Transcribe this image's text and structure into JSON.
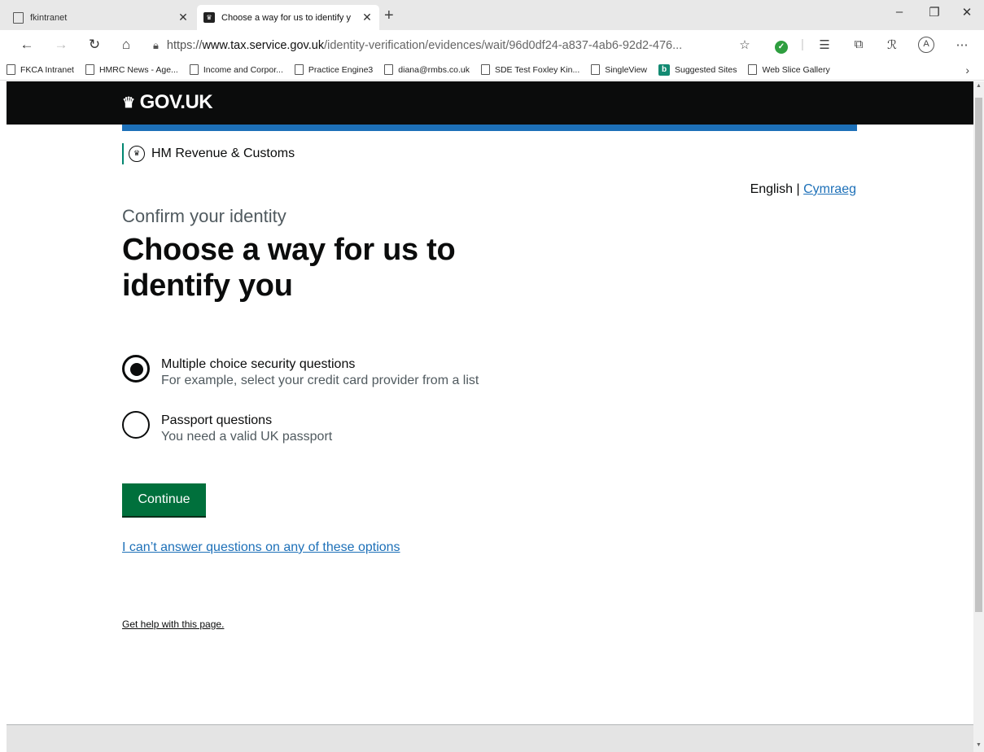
{
  "browser": {
    "tabs": [
      {
        "title": "fkintranet",
        "active": false
      },
      {
        "title": "Choose a way for us to identify y",
        "active": true
      }
    ],
    "url": {
      "scheme": "https://",
      "host": "www.tax.service.gov.uk",
      "path": "/identity-verification/evidences/wait/96d0df24-a837-4ab6-92d2-476..."
    },
    "favorites": [
      {
        "label": "FKCA Intranet",
        "icon": "page-icon"
      },
      {
        "label": "HMRC News - Age...",
        "icon": "page-icon"
      },
      {
        "label": "Income and Corpor...",
        "icon": "page-icon"
      },
      {
        "label": "Practice Engine3",
        "icon": "page-icon"
      },
      {
        "label": "diana@rmbs.co.uk",
        "icon": "page-icon"
      },
      {
        "label": "SDE Test  Foxley Kin...",
        "icon": "page-icon"
      },
      {
        "label": "SingleView",
        "icon": "page-icon"
      },
      {
        "label": "Suggested Sites",
        "icon": "bing-icon"
      },
      {
        "label": "Web Slice Gallery",
        "icon": "page-icon"
      }
    ]
  },
  "page": {
    "logo_text": "GOV.UK",
    "service_name": "HM Revenue & Customs",
    "lang_current": "English",
    "lang_separator": " | ",
    "lang_other": "Cymraeg",
    "caption": "Confirm your identity",
    "heading": "Choose a way for us to identify you",
    "options": [
      {
        "label": "Multiple choice security questions",
        "hint": "For example, select your credit card provider from a list",
        "checked": true
      },
      {
        "label": "Passport questions",
        "hint": "You need a valid UK passport",
        "checked": false
      }
    ],
    "continue_label": "Continue",
    "cant_answer_link": "I can’t answer questions on any of these options",
    "help_link": "Get help with this page."
  },
  "colors": {
    "header_black": "#0b0c0c",
    "brand_blue": "#1d70b8",
    "button_green": "#00703c",
    "hmrc_green": "#008670"
  }
}
